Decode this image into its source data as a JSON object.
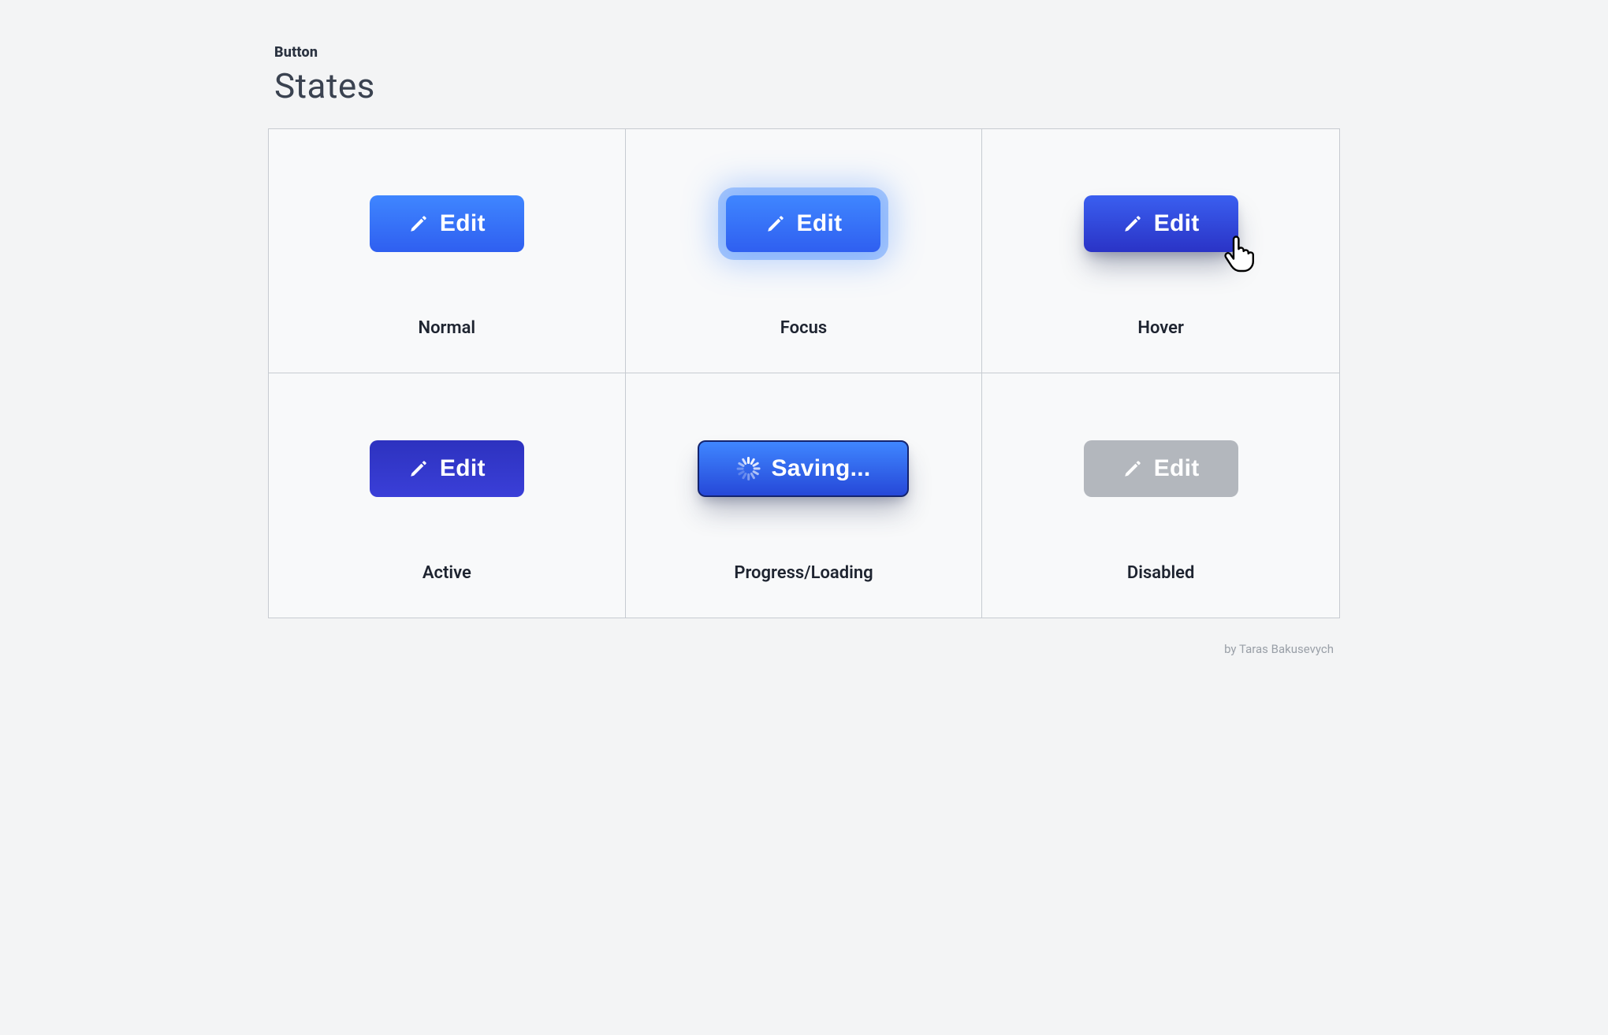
{
  "heading": {
    "overline": "Button",
    "title": "States"
  },
  "states": [
    {
      "label": "Normal",
      "button_text": "Edit",
      "icon": "pencil"
    },
    {
      "label": "Focus",
      "button_text": "Edit",
      "icon": "pencil"
    },
    {
      "label": "Hover",
      "button_text": "Edit",
      "icon": "pencil"
    },
    {
      "label": "Active",
      "button_text": "Edit",
      "icon": "pencil"
    },
    {
      "label": "Progress/Loading",
      "button_text": "Saving...",
      "icon": "spinner"
    },
    {
      "label": "Disabled",
      "button_text": "Edit",
      "icon": "pencil"
    }
  ],
  "credit": "by Taras Bakusevych"
}
